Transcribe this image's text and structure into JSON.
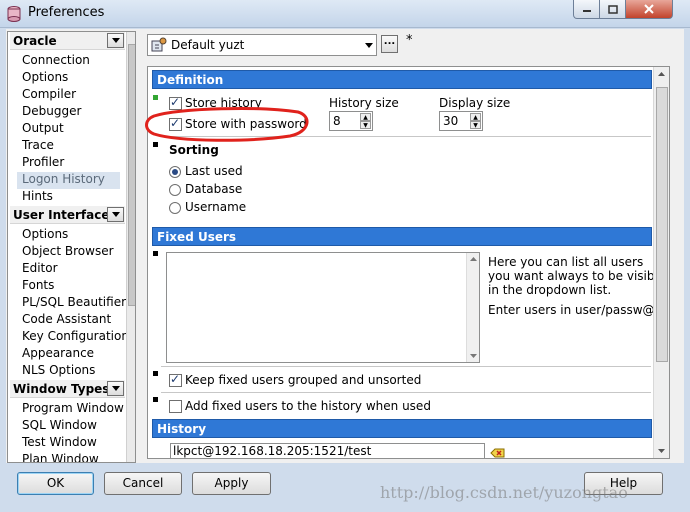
{
  "window": {
    "title": "Preferences"
  },
  "sidebar": {
    "groups": [
      {
        "title": "Oracle",
        "items": [
          "Connection",
          "Options",
          "Compiler",
          "Debugger",
          "Output",
          "Trace",
          "Profiler",
          "Logon History",
          "Hints"
        ],
        "selected": "Logon History"
      },
      {
        "title": "User Interface",
        "items": [
          "Options",
          "Object Browser",
          "Editor",
          "Fonts",
          "PL/SQL Beautifier",
          "Code Assistant",
          "Key Configuration",
          "Appearance",
          "NLS Options"
        ]
      },
      {
        "title": "Window Types",
        "items": [
          "Program Window",
          "SQL Window",
          "Test Window",
          "Plan Window"
        ]
      }
    ]
  },
  "profile": {
    "value": "Default yuzt",
    "dots_label": "...",
    "modified_marker": "*"
  },
  "definition": {
    "header": "Definition",
    "store_history": {
      "label": "Store history",
      "checked": true
    },
    "store_with_password": {
      "label": "Store with password",
      "checked": true
    },
    "history_size": {
      "label": "History size",
      "value": "8"
    },
    "display_size": {
      "label": "Display size",
      "value": "30"
    }
  },
  "sorting": {
    "header": "Sorting",
    "options": [
      {
        "label": "Last used",
        "selected": true
      },
      {
        "label": "Database",
        "selected": false
      },
      {
        "label": "Username",
        "selected": false
      }
    ]
  },
  "fixed_users": {
    "header": "Fixed Users",
    "help_lines": [
      "Here you can list all users",
      "you want always to be visible",
      "in the dropdown list.",
      "Enter users in user/passw@db s"
    ],
    "keep_grouped": {
      "label": "Keep fixed users grouped and unsorted",
      "checked": true
    },
    "add_to_history": {
      "label": "Add fixed users to the history when used",
      "checked": false
    }
  },
  "history": {
    "header": "History",
    "entry": "lkpct@192.168.18.205:1521/test"
  },
  "buttons": {
    "ok": "OK",
    "cancel": "Cancel",
    "apply": "Apply",
    "help": "Help"
  },
  "watermark": "http://blog.csdn.net/yuzongtao",
  "colors": {
    "section_header": "#2f78d6",
    "annotation": "#e0221c"
  }
}
